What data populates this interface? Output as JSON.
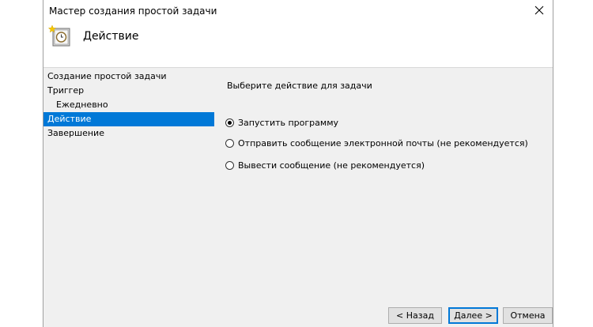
{
  "window": {
    "title": "Мастер создания простой задачи",
    "close_glyph": "✕"
  },
  "header": {
    "icon": "task-scheduler-clock-icon",
    "title": "Действие"
  },
  "sidebar": {
    "items": [
      {
        "label": "Создание простой задачи",
        "active": false,
        "indent": false
      },
      {
        "label": "Триггер",
        "active": false,
        "indent": false
      },
      {
        "label": "Ежедневно",
        "active": false,
        "indent": true
      },
      {
        "label": "Действие",
        "active": true,
        "indent": false
      },
      {
        "label": "Завершение",
        "active": false,
        "indent": false
      }
    ]
  },
  "content": {
    "prompt": "Выберите действие для задачи",
    "options": [
      {
        "label": "Запустить программу",
        "checked": true
      },
      {
        "label": "Отправить сообщение электронной почты (не рекомендуется)",
        "checked": false
      },
      {
        "label": "Вывести сообщение (не рекомендуется)",
        "checked": false
      }
    ]
  },
  "footer": {
    "back_label": "< Назад",
    "next_label": "Далее >",
    "cancel_label": "Отмена"
  },
  "colors": {
    "accent": "#0078d7",
    "window_bg": "#f0f0f0"
  }
}
